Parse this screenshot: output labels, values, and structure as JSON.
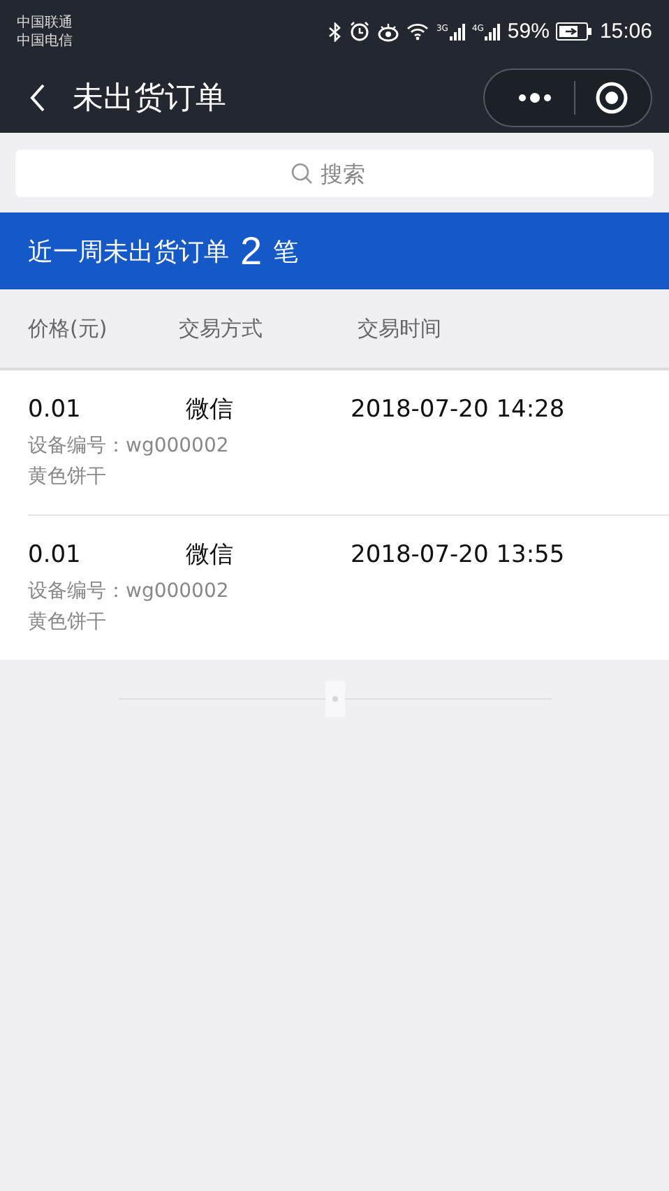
{
  "status_bar": {
    "carriers": [
      "中国联通",
      "中国电信"
    ],
    "network_labels": [
      "3G",
      "4G"
    ],
    "battery": "59%",
    "time": "15:06"
  },
  "nav": {
    "title": "未出货订单"
  },
  "search": {
    "placeholder": "搜索"
  },
  "summary": {
    "prefix": "近一周未出货订单",
    "count": "2",
    "suffix": "笔"
  },
  "table": {
    "columns": [
      "价格(元)",
      "交易方式",
      "交易时间"
    ],
    "rows": [
      {
        "price": "0.01",
        "method": "微信",
        "time": "2018-07-20 14:28",
        "device": "设备编号：wg000002",
        "product": "黄色饼干"
      },
      {
        "price": "0.01",
        "method": "微信",
        "time": "2018-07-20 13:55",
        "device": "设备编号：wg000002",
        "product": "黄色饼干"
      }
    ]
  }
}
